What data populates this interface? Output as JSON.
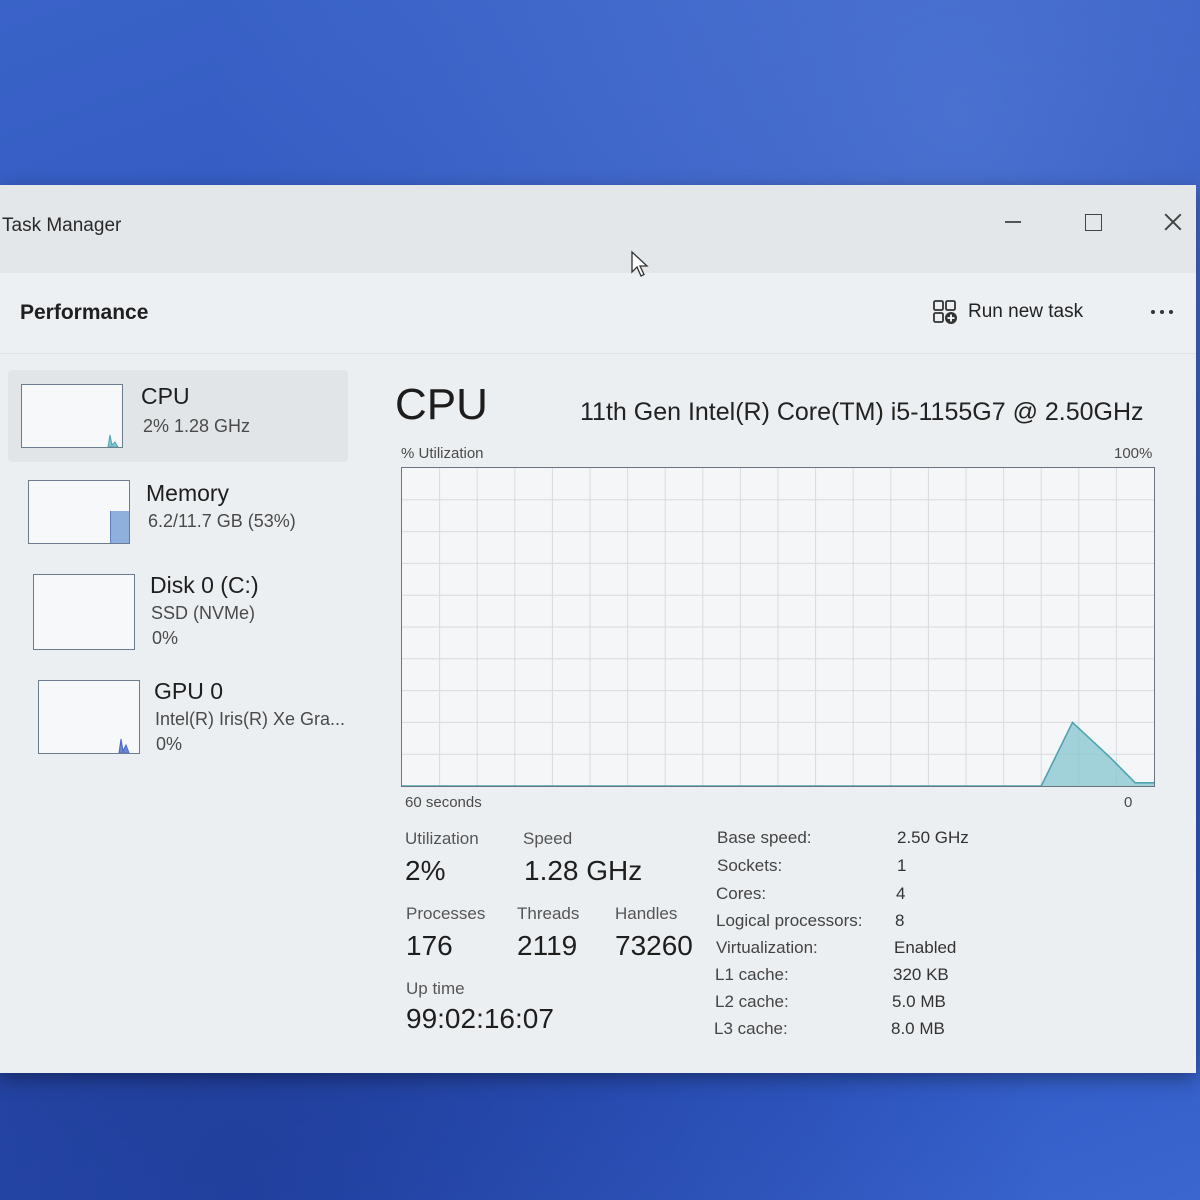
{
  "window": {
    "title": "Task Manager"
  },
  "header": {
    "page_title": "Performance",
    "run_new_task_label": "Run new task"
  },
  "sidebar": {
    "items": [
      {
        "title": "CPU",
        "line1": "2%  1.28 GHz",
        "line2": ""
      },
      {
        "title": "Memory",
        "line1": "6.2/11.7 GB (53%)",
        "line2": ""
      },
      {
        "title": "Disk 0 (C:)",
        "line1": "SSD (NVMe)",
        "line2": "0%"
      },
      {
        "title": "GPU 0",
        "line1": "Intel(R) Iris(R) Xe Gra...",
        "line2": "0%"
      }
    ]
  },
  "main": {
    "heading": "CPU",
    "model": "11th Gen Intel(R) Core(TM) i5-1155G7 @ 2.50GHz",
    "graph": {
      "y_label": "% Utilization",
      "y_max_label": "100%",
      "x_left_label": "60 seconds",
      "x_right_label": "0"
    },
    "stats": {
      "utilization_label": "Utilization",
      "utilization_value": "2%",
      "speed_label": "Speed",
      "speed_value": "1.28 GHz",
      "processes_label": "Processes",
      "processes_value": "176",
      "threads_label": "Threads",
      "threads_value": "2119",
      "handles_label": "Handles",
      "handles_value": "73260",
      "uptime_label": "Up time",
      "uptime_value": "99:02:16:07"
    },
    "specs": [
      {
        "label": "Base speed:",
        "value": "2.50 GHz"
      },
      {
        "label": "Sockets:",
        "value": "1"
      },
      {
        "label": "Cores:",
        "value": "4"
      },
      {
        "label": "Logical processors:",
        "value": "8"
      },
      {
        "label": "Virtualization:",
        "value": "Enabled"
      },
      {
        "label": "L1 cache:",
        "value": "320 KB"
      },
      {
        "label": "L2 cache:",
        "value": "5.0 MB"
      },
      {
        "label": "L3 cache:",
        "value": "8.0 MB"
      }
    ]
  },
  "chart_data": {
    "type": "area",
    "y_range": [
      0,
      100
    ],
    "x_range_seconds": [
      60,
      0
    ],
    "grid": true,
    "series": [
      {
        "x": [
          60,
          9,
          6.5,
          3.5,
          1.5,
          0
        ],
        "y": [
          0,
          0,
          20,
          9,
          1,
          1
        ]
      }
    ]
  },
  "colors": {
    "graph_line": "#4fa3b3",
    "graph_fill": "#86c6cf",
    "memory_fill": "#8fb0dd",
    "gpu_spike": "#4a68c9"
  }
}
